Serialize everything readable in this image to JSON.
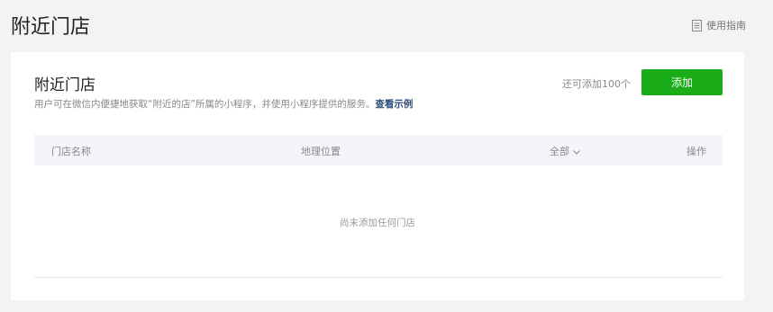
{
  "page": {
    "title": "附近门店",
    "guide_label": "使用指南"
  },
  "card": {
    "title": "附近门店",
    "description": "用户可在微信内便捷地获取“附近的店”所属的小程序，并使用小程序提供的服务。",
    "example_link": "查看示例",
    "remaining": "还可添加100个",
    "add_button": "添加"
  },
  "table": {
    "columns": {
      "name": "门店名称",
      "location": "地理位置",
      "filter": "全部",
      "action": "操作"
    },
    "empty_text": "尚未添加任何门店"
  },
  "colors": {
    "accent": "#1aad19",
    "link": "#2a4d7d"
  },
  "icons": {
    "guide": "document-icon",
    "filter": "chevron-down-icon"
  }
}
